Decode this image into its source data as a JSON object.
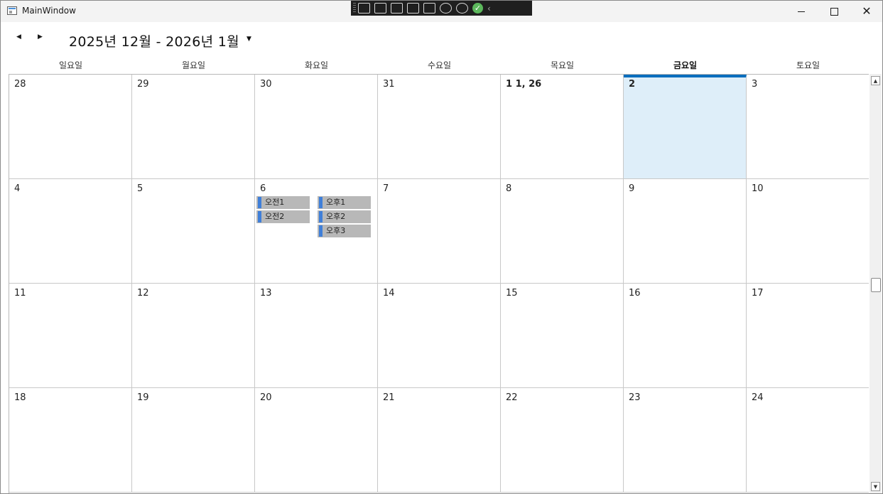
{
  "window": {
    "title": "MainWindow"
  },
  "devtools": {
    "icons": [
      "select-element-icon",
      "camera-icon",
      "pointer-icon",
      "frame-icon",
      "track-focus-icon",
      "hot-reload-icon",
      "accessibility-icon",
      "checkmark-icon",
      "collapse-chevron-icon"
    ]
  },
  "header": {
    "prev_glyph": "◀",
    "next_glyph": "▶",
    "title": "2025년 12월 - 2026년 1월",
    "dropdown_glyph": "▼"
  },
  "weekdays": [
    "일요일",
    "월요일",
    "화요일",
    "수요일",
    "목요일",
    "금요일",
    "토요일"
  ],
  "today_weekday_index": 5,
  "weeks": [
    [
      "28",
      "29",
      "30",
      "31",
      "1 1, 26",
      "2",
      "3"
    ],
    [
      "4",
      "5",
      "6",
      "7",
      "8",
      "9",
      "10"
    ],
    [
      "11",
      "12",
      "13",
      "14",
      "15",
      "16",
      "17"
    ],
    [
      "18",
      "19",
      "20",
      "21",
      "22",
      "23",
      "24"
    ]
  ],
  "today": {
    "week": 0,
    "day": 5
  },
  "events_day": {
    "week": 1,
    "day": 2
  },
  "events": {
    "morning": [
      "오전1",
      "오전2"
    ],
    "afternoon": [
      "오후1",
      "오후2",
      "오후3"
    ]
  },
  "colors": {
    "accent": "#0a6ebd",
    "today_bg": "#deeef9",
    "event_bg": "#b8b8b8",
    "event_bar": "#3f7fd9"
  },
  "scrollbar": {
    "up_glyph": "▲",
    "down_glyph": "▼"
  }
}
